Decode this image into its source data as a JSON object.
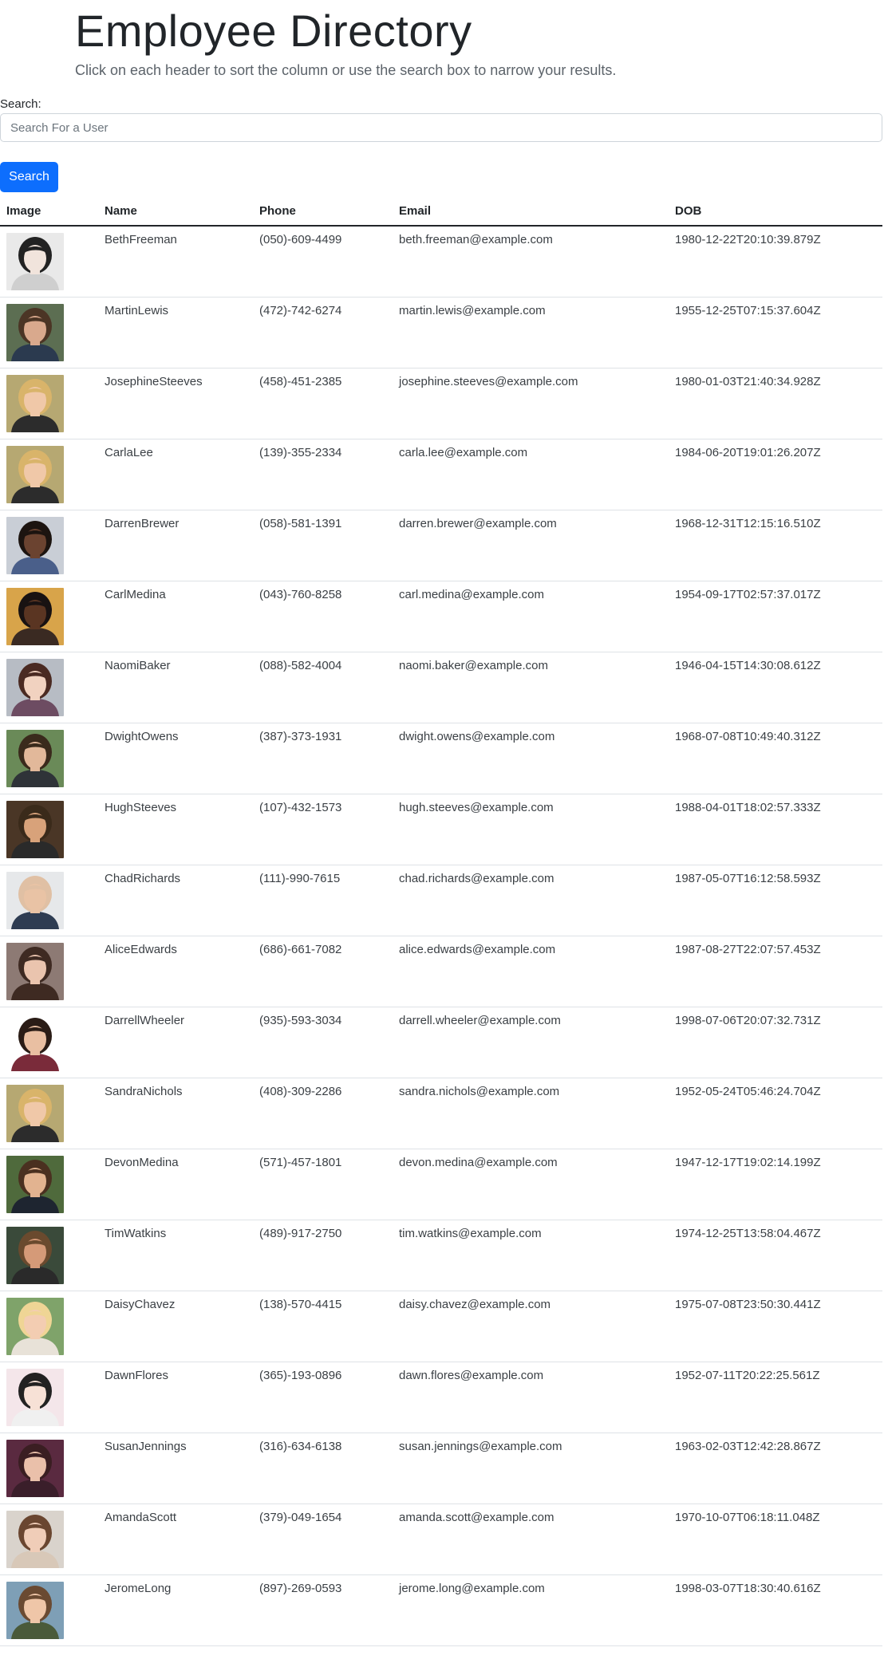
{
  "header": {
    "title": "Employee Directory",
    "subtitle": "Click on each header to sort the column or use the search box to narrow your results."
  },
  "search": {
    "label": "Search:",
    "placeholder": "Search For a User",
    "button_label": "Search"
  },
  "table": {
    "columns": [
      "Image",
      "Name",
      "Phone",
      "Email",
      "DOB"
    ],
    "rows": [
      {
        "name": "BethFreeman",
        "phone": "(050)-609-4499",
        "email": "beth.freeman@example.com",
        "dob": "1980-12-22T20:10:39.879Z",
        "bg": "#e9e9e9",
        "skin": "#f1e4dc",
        "hair": "#222222",
        "shirt": "#cfcfcf"
      },
      {
        "name": "MartinLewis",
        "phone": "(472)-742-6274",
        "email": "martin.lewis@example.com",
        "dob": "1955-12-25T07:15:37.604Z",
        "bg": "#5c6e52",
        "skin": "#d9a98d",
        "hair": "#4b3525",
        "shirt": "#2b3a4f"
      },
      {
        "name": "JosephineSteeves",
        "phone": "(458)-451-2385",
        "email": "josephine.steeves@example.com",
        "dob": "1980-01-03T21:40:34.928Z",
        "bg": "#b6a872",
        "skin": "#f0c8a8",
        "hair": "#d9b46a",
        "shirt": "#2c2c2c"
      },
      {
        "name": "CarlaLee",
        "phone": "(139)-355-2334",
        "email": "carla.lee@example.com",
        "dob": "1984-06-20T19:01:26.207Z",
        "bg": "#b6a872",
        "skin": "#f0c8a8",
        "hair": "#d9b46a",
        "shirt": "#2c2c2c"
      },
      {
        "name": "DarrenBrewer",
        "phone": "(058)-581-1391",
        "email": "darren.brewer@example.com",
        "dob": "1968-12-31T12:15:16.510Z",
        "bg": "#c9ced6",
        "skin": "#6b4330",
        "hair": "#1c1410",
        "shirt": "#4a5f8a"
      },
      {
        "name": "CarlMedina",
        "phone": "(043)-760-8258",
        "email": "carl.medina@example.com",
        "dob": "1954-09-17T02:57:37.017Z",
        "bg": "#d8a44a",
        "skin": "#5a3522",
        "hair": "#181212",
        "shirt": "#3a2a22"
      },
      {
        "name": "NaomiBaker",
        "phone": "(088)-582-4004",
        "email": "naomi.baker@example.com",
        "dob": "1946-04-15T14:30:08.612Z",
        "bg": "#b7bcc4",
        "skin": "#f1d2c0",
        "hair": "#4a2a22",
        "shirt": "#6d4c62"
      },
      {
        "name": "DwightOwens",
        "phone": "(387)-373-1931",
        "email": "dwight.owens@example.com",
        "dob": "1968-07-08T10:49:40.312Z",
        "bg": "#6a8a58",
        "skin": "#e2b89a",
        "hair": "#3a2a1c",
        "shirt": "#2f3338"
      },
      {
        "name": "HughSteeves",
        "phone": "(107)-432-1573",
        "email": "hugh.steeves@example.com",
        "dob": "1988-04-01T18:02:57.333Z",
        "bg": "#4a3626",
        "skin": "#d8a27a",
        "hair": "#3a2a1a",
        "shirt": "#2a2a2a"
      },
      {
        "name": "ChadRichards",
        "phone": "(111)-990-7615",
        "email": "chad.richards@example.com",
        "dob": "1987-05-07T16:12:58.593Z",
        "bg": "#e6e8ea",
        "skin": "#e9c3a5",
        "hair": "#e0c0a4",
        "shirt": "#2e3c52"
      },
      {
        "name": "AliceEdwards",
        "phone": "(686)-661-7082",
        "email": "alice.edwards@example.com",
        "dob": "1987-08-27T22:07:57.453Z",
        "bg": "#8d7a74",
        "skin": "#eac4ae",
        "hair": "#3e2a22",
        "shirt": "#3e2a22"
      },
      {
        "name": "DarrellWheeler",
        "phone": "(935)-593-3034",
        "email": "darrell.wheeler@example.com",
        "dob": "1998-07-06T20:07:32.731Z",
        "bg": "#ffffff",
        "skin": "#e9bfa2",
        "hair": "#2a1c16",
        "shirt": "#7a2b3a"
      },
      {
        "name": "SandraNichols",
        "phone": "(408)-309-2286",
        "email": "sandra.nichols@example.com",
        "dob": "1952-05-24T05:46:24.704Z",
        "bg": "#b6a872",
        "skin": "#f0c8a8",
        "hair": "#d9b46a",
        "shirt": "#2c2c2c"
      },
      {
        "name": "DevonMedina",
        "phone": "(571)-457-1801",
        "email": "devon.medina@example.com",
        "dob": "1947-12-17T19:02:14.199Z",
        "bg": "#4f6a3c",
        "skin": "#e2b390",
        "hair": "#4a3020",
        "shirt": "#1e2530"
      },
      {
        "name": "TimWatkins",
        "phone": "(489)-917-2750",
        "email": "tim.watkins@example.com",
        "dob": "1974-12-25T13:58:04.467Z",
        "bg": "#3a4a3a",
        "skin": "#d59a78",
        "hair": "#6a4a2e",
        "shirt": "#2a2a2a"
      },
      {
        "name": "DaisyChavez",
        "phone": "(138)-570-4415",
        "email": "daisy.chavez@example.com",
        "dob": "1975-07-08T23:50:30.441Z",
        "bg": "#7fa36a",
        "skin": "#f3cdb2",
        "hair": "#efd595",
        "shirt": "#e8e2d8"
      },
      {
        "name": "DawnFlores",
        "phone": "(365)-193-0896",
        "email": "dawn.flores@example.com",
        "dob": "1952-07-11T20:22:25.561Z",
        "bg": "#f4e6ea",
        "skin": "#f7e1d6",
        "hair": "#222222",
        "shirt": "#f0f0f0"
      },
      {
        "name": "SusanJennings",
        "phone": "(316)-634-6138",
        "email": "susan.jennings@example.com",
        "dob": "1963-02-03T12:42:28.867Z",
        "bg": "#5a2a40",
        "skin": "#eac0aa",
        "hair": "#3a1e22",
        "shirt": "#3a1e2a"
      },
      {
        "name": "AmandaScott",
        "phone": "(379)-049-1654",
        "email": "amanda.scott@example.com",
        "dob": "1970-10-07T06:18:11.048Z",
        "bg": "#d9d3cc",
        "skin": "#f0cdb8",
        "hair": "#6a4630",
        "shirt": "#d8c8b8"
      },
      {
        "name": "JeromeLong",
        "phone": "(897)-269-0593",
        "email": "jerome.long@example.com",
        "dob": "1998-03-07T18:30:40.616Z",
        "bg": "#7e9fb6",
        "skin": "#efc6a8",
        "hair": "#6a4a32",
        "shirt": "#4a5a3a"
      }
    ]
  }
}
